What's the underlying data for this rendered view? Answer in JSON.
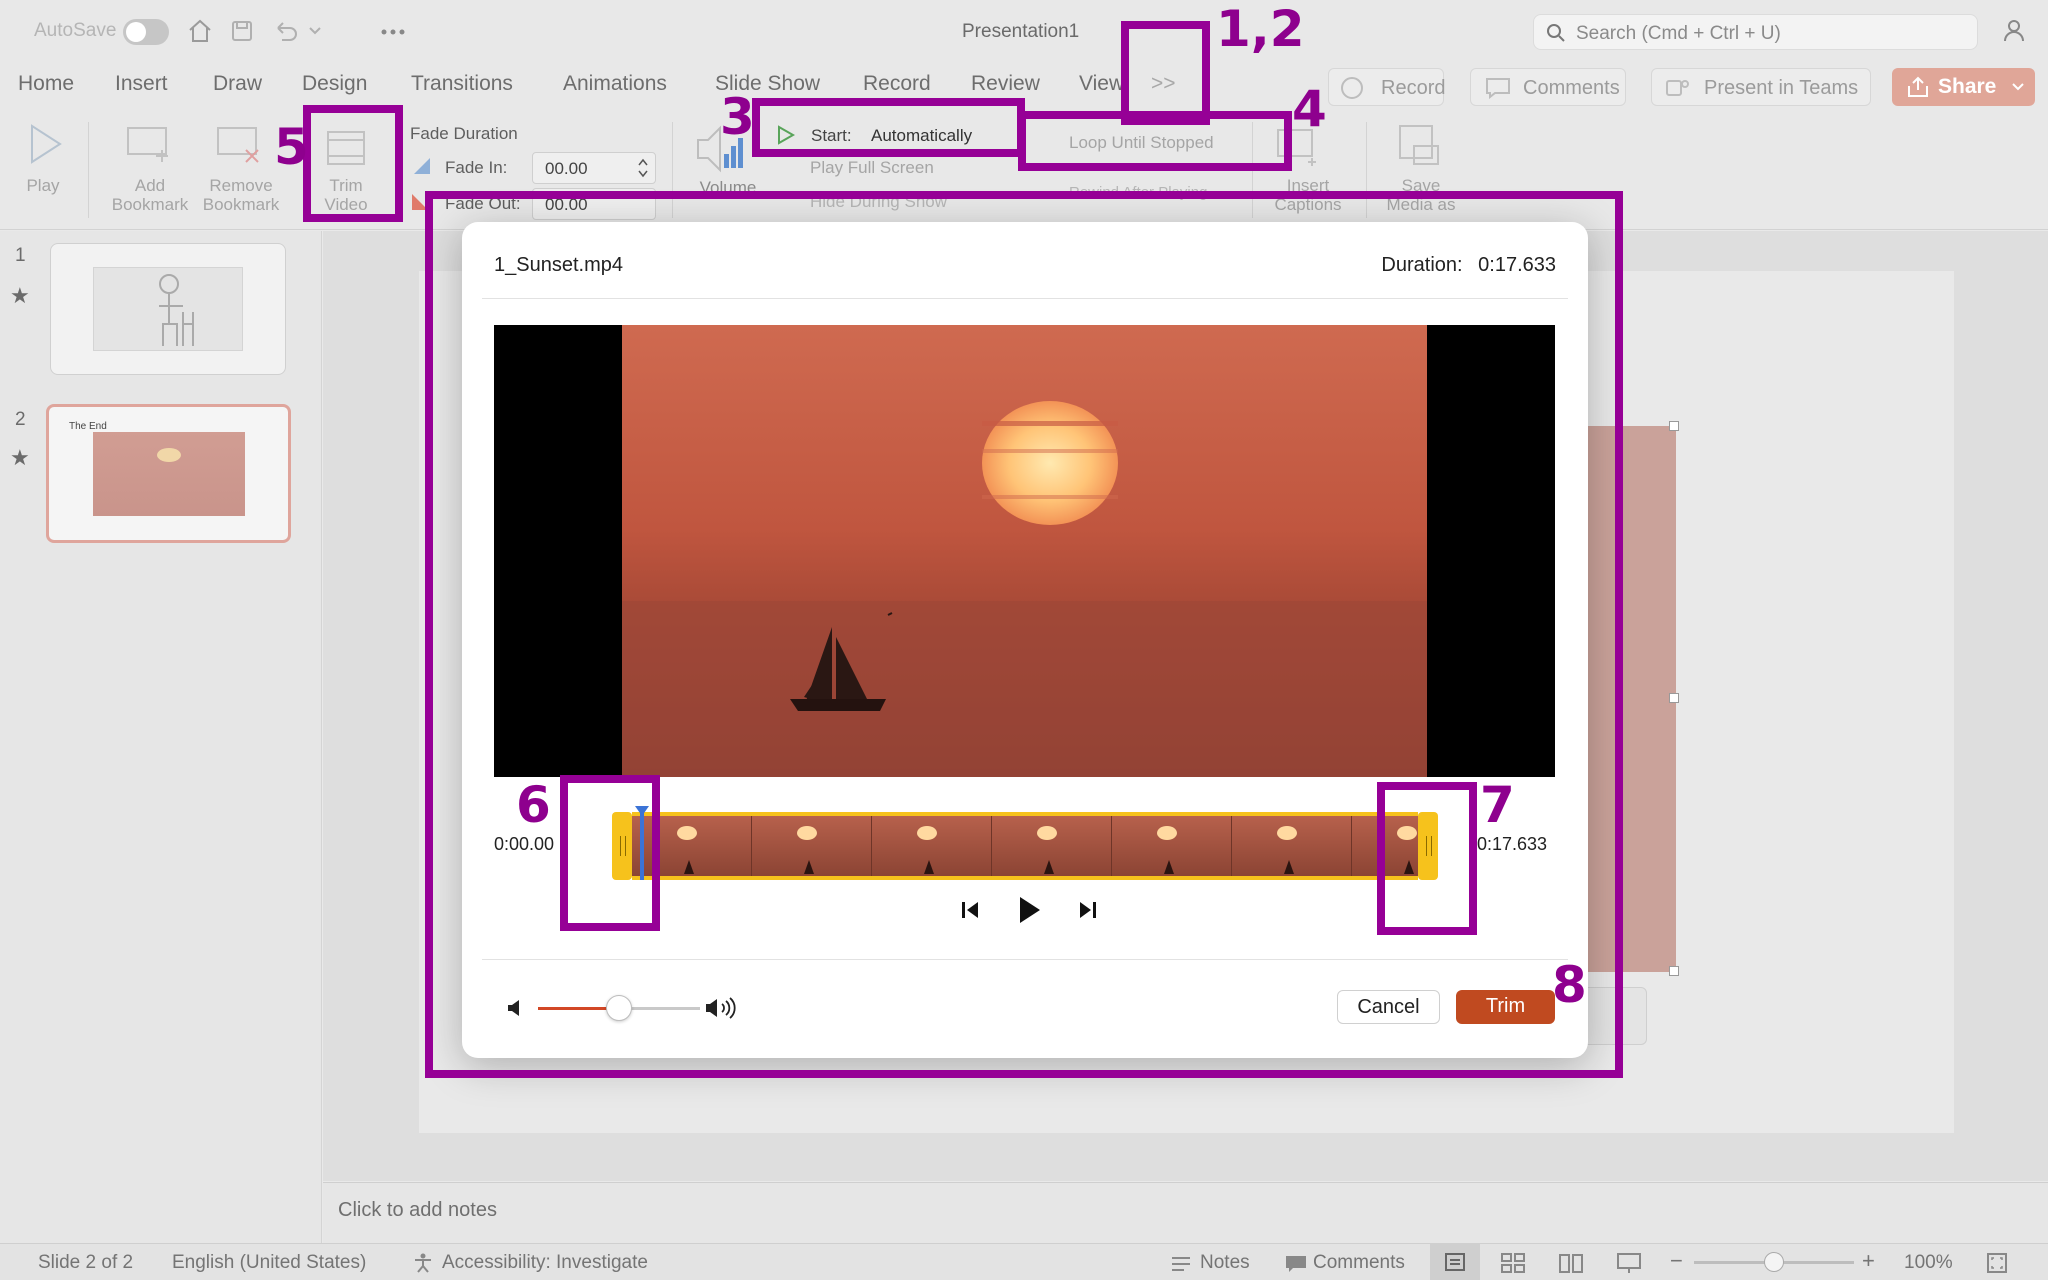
{
  "titlebar": {
    "autosave_label": "AutoSave",
    "doc_title": "Presentation1",
    "search_placeholder": "Search (Cmd + Ctrl + U)"
  },
  "tabs": [
    {
      "label": "Home"
    },
    {
      "label": "Insert"
    },
    {
      "label": "Draw"
    },
    {
      "label": "Design"
    },
    {
      "label": "Transitions"
    },
    {
      "label": "Animations"
    },
    {
      "label": "Slide Show"
    },
    {
      "label": "Record"
    },
    {
      "label": "Review"
    },
    {
      "label": "View"
    }
  ],
  "tab_overflow_label": ">>",
  "header_buttons": {
    "record": "Record",
    "comments": "Comments",
    "present_teams": "Present in Teams",
    "share": "Share"
  },
  "ribbon": {
    "play": "Play",
    "add_bookmark": "Add Bookmark",
    "remove_bookmark": "Remove Bookmark",
    "trim_video": "Trim Video",
    "fade_duration": "Fade Duration",
    "fade_in_label": "Fade In:",
    "fade_in_value": "00.00",
    "fade_out_label": "Fade Out:",
    "fade_out_value": "00.00",
    "volume": "Volume",
    "start_label": "Start:",
    "start_value": "Automatically",
    "play_full_screen": "Play Full Screen",
    "hide_during_show": "Hide During Show",
    "loop_until_stopped": "Loop Until Stopped",
    "rewind_after_playing": "Rewind After Playing",
    "insert_captions": "Insert Captions",
    "save_media_as": "Save Media as"
  },
  "slides": [
    {
      "number": "1"
    },
    {
      "number": "2",
      "title": "The End"
    }
  ],
  "notes_placeholder": "Click to add notes",
  "status": {
    "slide_count": "Slide 2 of 2",
    "language": "English (United States)",
    "accessibility": "Accessibility: Investigate",
    "notes": "Notes",
    "comments": "Comments",
    "zoom": "100%",
    "zoom_level": 1.0
  },
  "dialog": {
    "file_name": "1_Sunset.mp4",
    "duration_label": "Duration:",
    "duration_value": "0:17.633",
    "start_time": "0:00.00",
    "end_time": "0:17.633",
    "cancel": "Cancel",
    "trim": "Trim",
    "volume_level": 0.5
  },
  "annotations": [
    "1,2",
    "3",
    "4",
    "5",
    "6",
    "7",
    "8"
  ],
  "colors": {
    "accent": "#c04a20",
    "annotation": "#960096",
    "trim_handle": "#f6c21c",
    "playhead": "#3b73d6"
  }
}
